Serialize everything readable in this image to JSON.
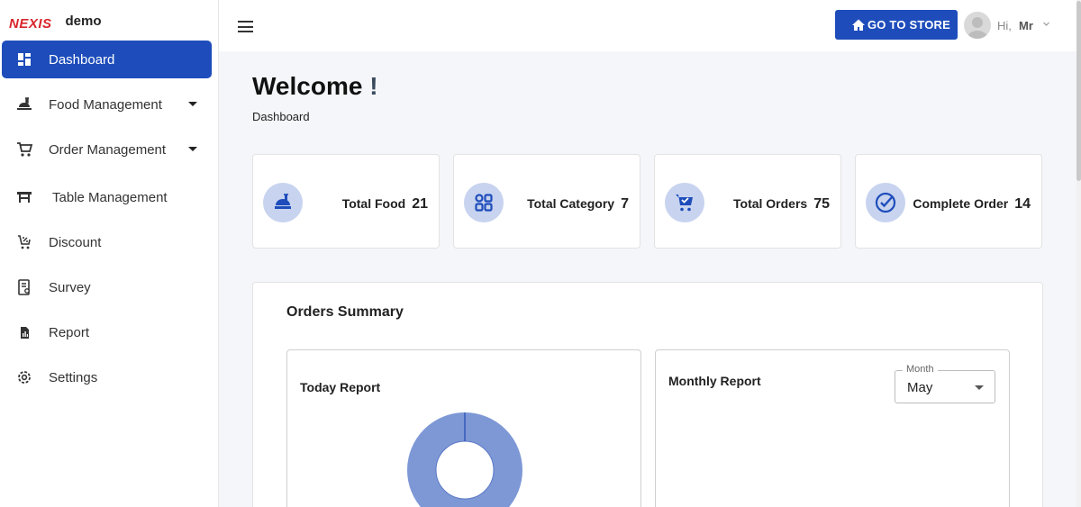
{
  "brand": {
    "logo": "NEXIS",
    "name": "demo"
  },
  "sidebar": {
    "items": [
      {
        "label": "Dashboard",
        "icon": "dashboard-icon",
        "active": true
      },
      {
        "label": "Food Management",
        "icon": "food-icon",
        "has_submenu": true
      },
      {
        "label": "Order Management",
        "icon": "cart-icon",
        "has_submenu": true
      },
      {
        "label": "Table Management",
        "icon": "table-icon"
      },
      {
        "label": "Discount",
        "icon": "discount-icon"
      },
      {
        "label": "Survey",
        "icon": "survey-icon"
      },
      {
        "label": "Report",
        "icon": "report-icon"
      },
      {
        "label": "Settings",
        "icon": "gear-icon"
      }
    ]
  },
  "topbar": {
    "store_button": "GO TO STORE",
    "greeting": "Hi,",
    "user_name": "Mr"
  },
  "page": {
    "title": "Welcome",
    "title_mark": "!",
    "breadcrumb": "Dashboard"
  },
  "stats": [
    {
      "label": "Total Food",
      "value": "21",
      "icon": "food-bag-icon"
    },
    {
      "label": "Total Category",
      "value": "7",
      "icon": "category-grid-icon"
    },
    {
      "label": "Total Orders",
      "value": "75",
      "icon": "cart-check-icon"
    },
    {
      "label": "Complete Order",
      "value": "14",
      "icon": "check-circle-icon"
    }
  ],
  "summary": {
    "title": "Orders Summary",
    "today": {
      "title": "Today Report"
    },
    "monthly": {
      "title": "Monthly Report",
      "month_label": "Month",
      "month_value": "May"
    }
  },
  "colors": {
    "accent": "#1e4dbb",
    "icon_bg": "#c7d3ef",
    "donut": "#7e98d6",
    "brand": "#d8262b"
  }
}
